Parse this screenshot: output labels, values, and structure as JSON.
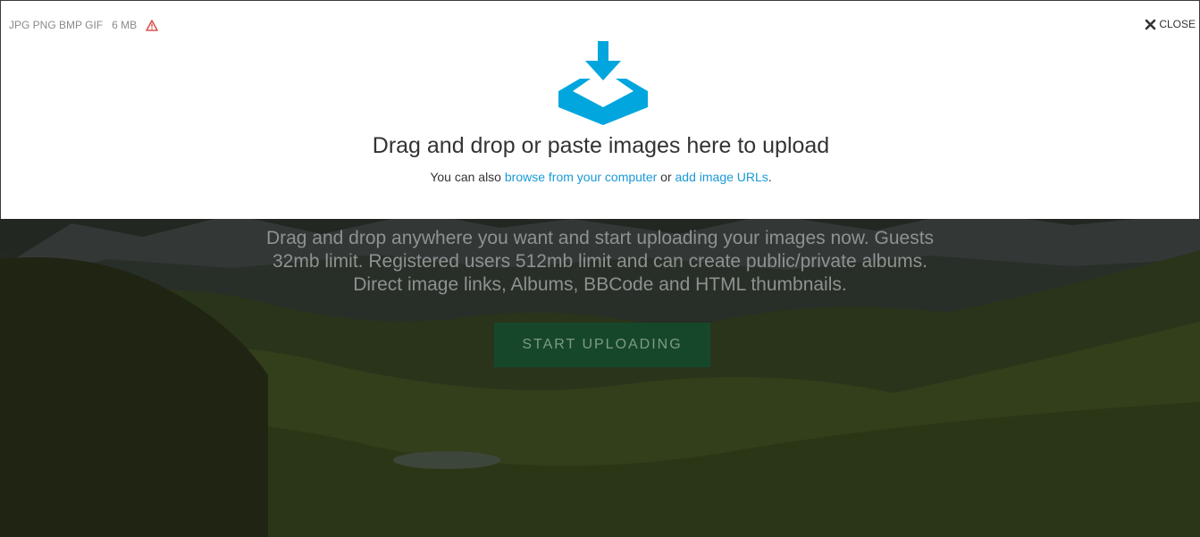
{
  "upload_panel": {
    "formats": "JPG PNG BMP GIF",
    "max_size": "6 MB",
    "close_label": "CLOSE",
    "title": "Drag and drop or paste images here to upload",
    "sub_prefix": "You can also",
    "browse_link": "browse from your computer",
    "sub_or": "or",
    "url_link": "add image URLs",
    "sub_suffix": "."
  },
  "hero": {
    "lines": [
      "Drag and drop anywhere you want and start uploading your images now. Guests",
      "32mb limit. Registered users 512mb limit and can create public/private albums.",
      "Direct image links, Albums, BBCode and HTML thumbnails."
    ],
    "button_label": "START UPLOADING"
  },
  "colors": {
    "accent": "#00a6dd",
    "link": "#1a9ad6",
    "warning": "#d9534f",
    "button_bg": "#16472b"
  },
  "icons": {
    "upload": "tray-download-icon",
    "warning": "warning-triangle-icon",
    "close": "close-icon"
  }
}
